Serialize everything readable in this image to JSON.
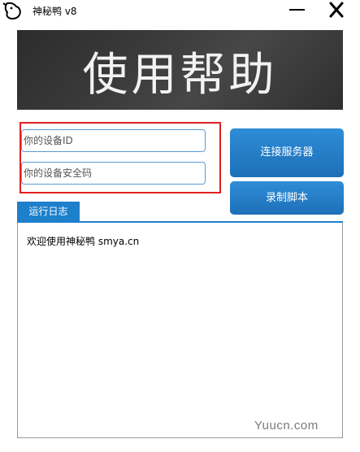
{
  "window": {
    "title": "神秘鸭 v8",
    "minimize_icon": "minimize-icon",
    "close_icon": "close-icon",
    "app_icon": "duck-app-icon"
  },
  "banner": {
    "text": "使用帮助"
  },
  "form": {
    "device_id_placeholder": "你的设备ID",
    "device_id_value": "",
    "security_code_placeholder": "你的设备安全码",
    "security_code_value": ""
  },
  "buttons": {
    "connect_label": "连接服务器",
    "record_label": "录制脚本"
  },
  "log": {
    "tab_label": "运行日志",
    "lines": [
      "欢迎使用神秘鸭 smya.cn"
    ]
  },
  "watermark": {
    "text": "Yuucn.com"
  },
  "colors": {
    "accent_blue": "#1e7fcb",
    "highlight_red": "#e02020",
    "banner_dark": "#333333"
  }
}
